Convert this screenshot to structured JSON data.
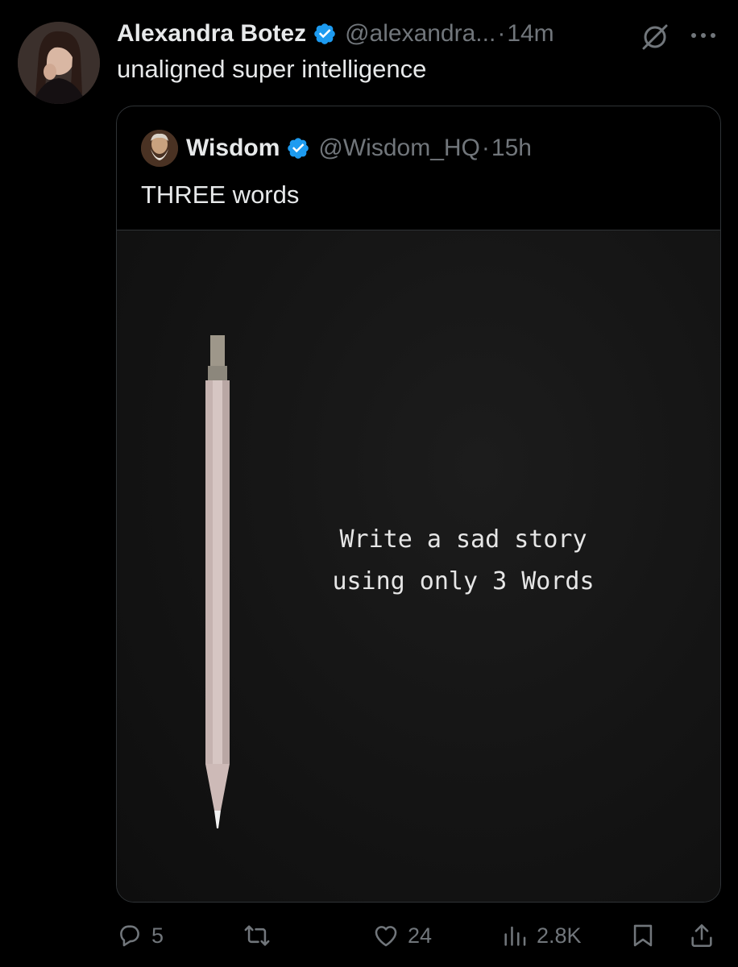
{
  "post": {
    "author_name": "Alexandra Botez",
    "handle": "@alexandra...",
    "separator": "·",
    "time": "14m",
    "text": "unaligned super intelligence",
    "avatar_icon": "profile-photo"
  },
  "quoted": {
    "author_name": "Wisdom",
    "handle": "@Wisdom_HQ",
    "separator": "·",
    "time": "15h",
    "text": "THREE words",
    "media_caption": "Write a sad story\nusing only 3 Words"
  },
  "actions": {
    "replies": "5",
    "reposts": "",
    "likes": "24",
    "views": "2.8K"
  },
  "icons": {
    "verified": "verified-badge-icon",
    "grok": "grok-icon",
    "more": "more-icon",
    "reply": "reply-icon",
    "repost": "repost-icon",
    "like": "heart-icon",
    "views": "views-icon",
    "bookmark": "bookmark-icon",
    "share": "share-icon"
  },
  "colors": {
    "background": "#000000",
    "text": "#e7e9ea",
    "muted": "#71767b",
    "verified": "#1d9bf0",
    "border": "#2f3336"
  }
}
